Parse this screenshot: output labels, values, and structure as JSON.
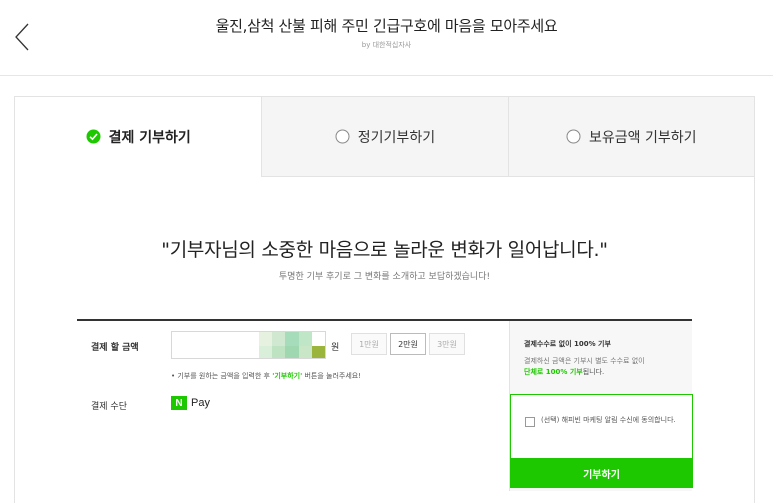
{
  "header": {
    "title": "울진,삼척 산불 피해 주민 긴급구호에 마음을 모아주세요",
    "byline": "by 대한적십자사"
  },
  "tabs": [
    {
      "label": "결제 기부하기",
      "active": true,
      "icon": "check-circle-icon"
    },
    {
      "label": "정기기부하기",
      "active": false,
      "icon": "radio-circle-icon"
    },
    {
      "label": "보유금액 기부하기",
      "active": false,
      "icon": "radio-circle-icon"
    }
  ],
  "headline": {
    "quote": "\"기부자님의 소중한 마음으로 놀라운 변화가 일어납니다.\"",
    "sub": "투명한 기부 후기로 그 변화를 소개하고 보답하겠습니다!"
  },
  "form": {
    "amount_label": "결제 할 금액",
    "currency_unit": "원",
    "presets": [
      {
        "label": "1만원",
        "selected": false
      },
      {
        "label": "2만원",
        "selected": true
      },
      {
        "label": "3만원",
        "selected": false
      }
    ],
    "hint_prefix": "• 기부를 원하는 금액을 입력한 후 ",
    "hint_highlight": "'기부하기'",
    "hint_suffix": " 버튼을 눌러주세요!",
    "method_label": "결제 수단",
    "method_value": "Pay",
    "method_badge": "N"
  },
  "side": {
    "title": "결제수수료 없이 100% 기부",
    "desc": "결제하신 금액은 기부시 별도 수수료 없이",
    "desc2_highlight": "단체로 100% 기부",
    "desc2_suffix": "됩니다.",
    "consent": "(선택) 해피빈 마케팅 알림 수신에 동의합니다.",
    "donate_button": "기부하기"
  },
  "colors": {
    "accent": "#1ec800",
    "mosaic": [
      "#e6f1e0",
      "#cfe8cf",
      "#a6dcb9",
      "#bfe6c6",
      "#ffffff",
      "#d9efd9",
      "#bde3c3",
      "#9fd8b0",
      "#c9e7c6",
      "#9bb43c"
    ]
  }
}
